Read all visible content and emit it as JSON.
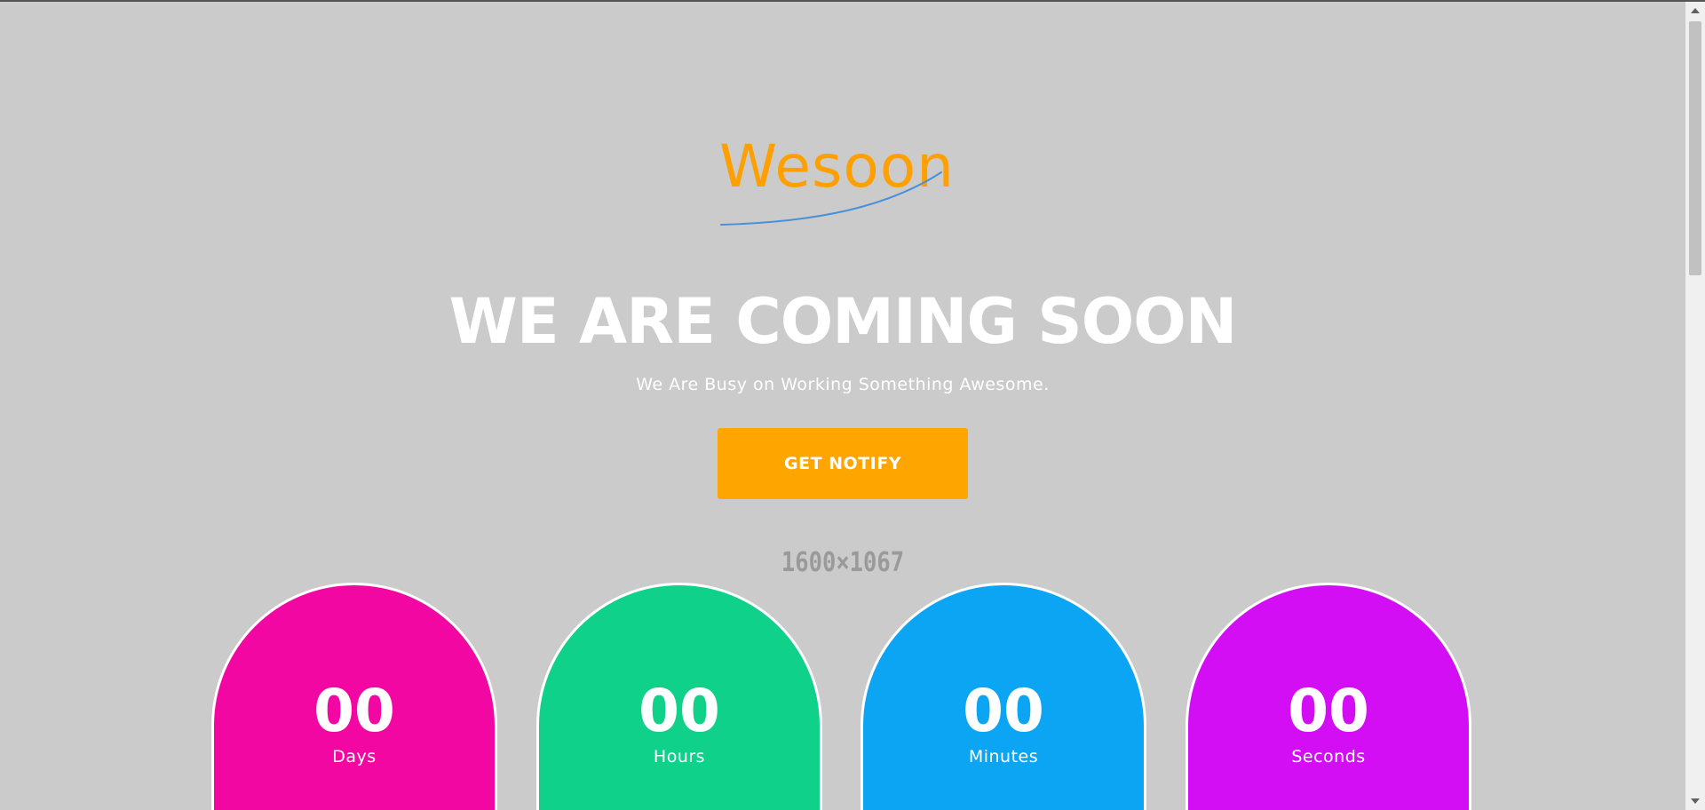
{
  "brand": {
    "logo_text": "Wesoon",
    "logo_color": "#ffa000",
    "swoosh_color": "#4a90d9"
  },
  "hero": {
    "headline": "WE ARE COMING SOON",
    "subtitle": "We Are Busy on Working Something Awesome.",
    "notify_button": "GET NOTIFY",
    "placeholder_size": "1600×1067"
  },
  "countdown": [
    {
      "value": "00",
      "label": "Days",
      "color": "#f307a2"
    },
    {
      "value": "00",
      "label": "Hours",
      "color": "#0fd18a"
    },
    {
      "value": "00",
      "label": "Minutes",
      "color": "#0ba5f3"
    },
    {
      "value": "00",
      "label": "Seconds",
      "color": "#d30ef5"
    }
  ],
  "theme": {
    "background": "#cbcbcb",
    "button_color": "#ffa500"
  }
}
